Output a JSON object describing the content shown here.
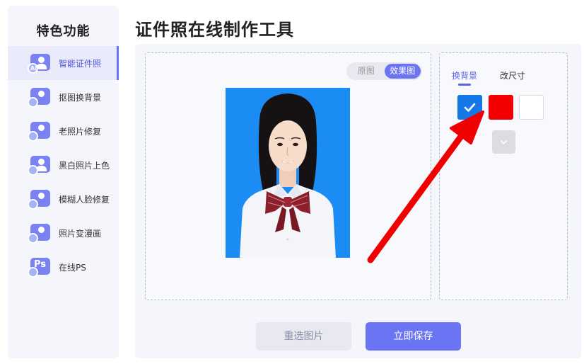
{
  "sidebar": {
    "title": "特色功能",
    "items": [
      {
        "label": "智能证件照",
        "icon": "ai-id-photo-icon"
      },
      {
        "label": "抠图换背景",
        "icon": "cutout-icon"
      },
      {
        "label": "老照片修复",
        "icon": "camera-repair-icon"
      },
      {
        "label": "黑白照片上色",
        "icon": "colorize-icon"
      },
      {
        "label": "模糊人脸修复",
        "icon": "face-repair-icon"
      },
      {
        "label": "照片变漫画",
        "icon": "cartoon-icon"
      },
      {
        "label": "在线PS",
        "icon": "ps-icon"
      }
    ]
  },
  "page": {
    "title": "证件照在线制作工具"
  },
  "preview": {
    "tabs": [
      "原图",
      "效果图"
    ],
    "active_tab": "效果图"
  },
  "photo": {
    "background_color": "#1c8cf5"
  },
  "settings": {
    "tabs": [
      "换背景",
      "改尺寸"
    ],
    "active_tab": "换背景",
    "colors": [
      "#1678e6",
      "#f50000",
      "#ffffff"
    ],
    "selected_color": "#1678e6"
  },
  "actions": {
    "reselect_label": "重选图片",
    "save_label": "立即保存"
  },
  "colors": {
    "accent": "#6b74f2",
    "annotation_arrow": "#f00000"
  }
}
